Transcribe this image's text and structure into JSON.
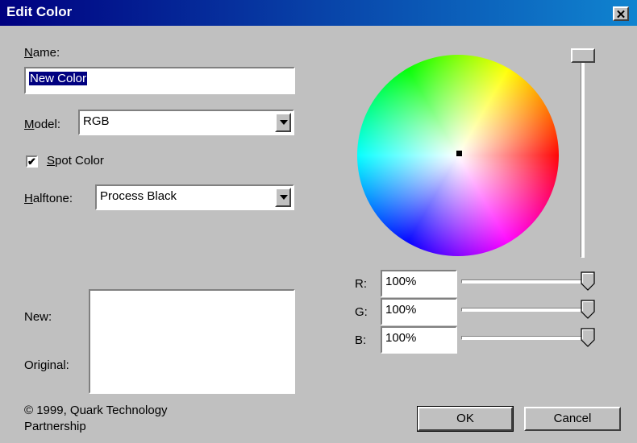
{
  "window": {
    "title": "Edit Color",
    "close_glyph": "✕"
  },
  "name": {
    "label": "Name:",
    "value": "New Color"
  },
  "model": {
    "label": "Model:",
    "value": "RGB"
  },
  "spot_color": {
    "label": "Spot Color",
    "checked": true,
    "check_glyph": "✔"
  },
  "halftone": {
    "label": "Halftone:",
    "value": "Process Black"
  },
  "preview": {
    "new_label": "New:",
    "original_label": "Original:",
    "new_color": "#ffffff",
    "original_color": "#ffffff"
  },
  "copyright": {
    "line1": "© 1999, Quark Technology",
    "line2": "Partnership"
  },
  "brightness": {
    "level": 1.0
  },
  "channels": [
    {
      "label": "R:",
      "value": "100%",
      "level": 1.0
    },
    {
      "label": "G:",
      "value": "100%",
      "level": 1.0
    },
    {
      "label": "B:",
      "value": "100%",
      "level": 1.0
    }
  ],
  "buttons": {
    "ok": "OK",
    "cancel": "Cancel"
  },
  "colors": {
    "titlebar_start": "#000080",
    "titlebar_end": "#1084d0",
    "dialog": "#c0c0c0",
    "selection": "#000080"
  },
  "icons": {
    "close": "close-icon",
    "dropdown": "chevron-down-icon",
    "check": "check-icon"
  }
}
